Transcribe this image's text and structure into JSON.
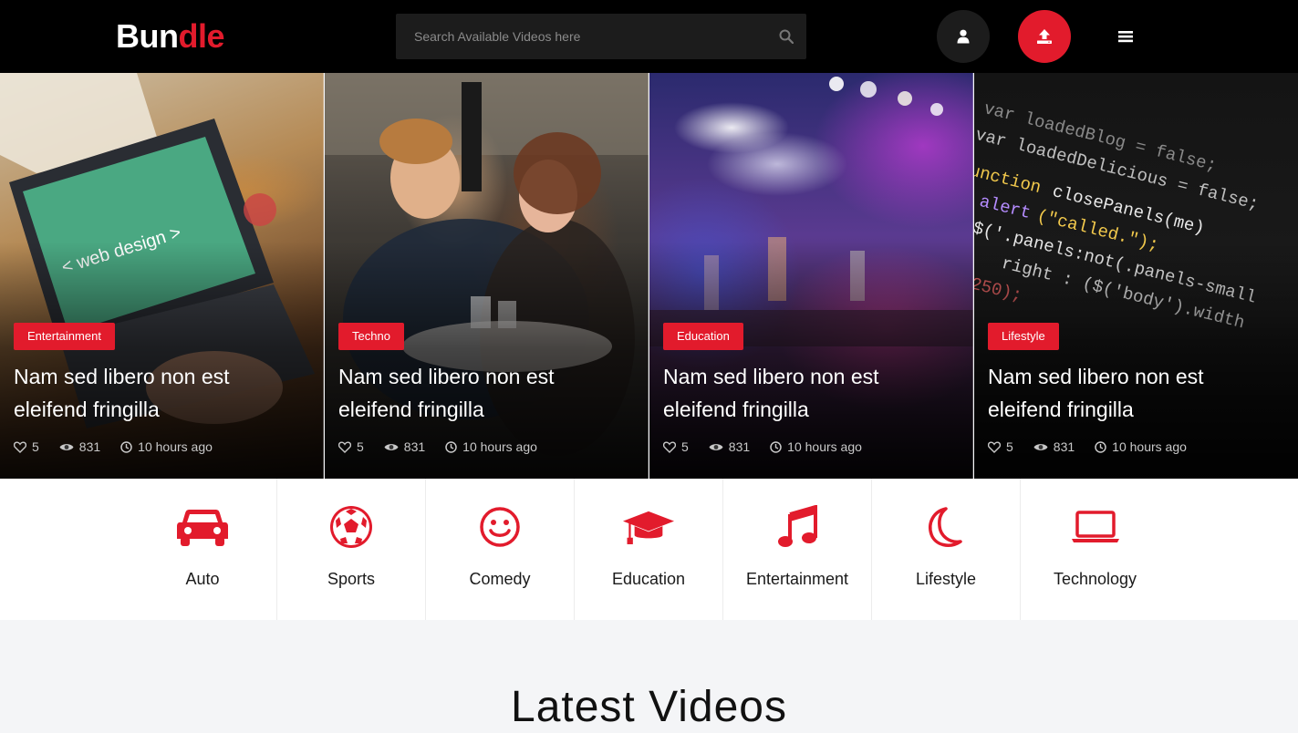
{
  "logo": {
    "part1": "Bun",
    "part2": "dle"
  },
  "search": {
    "placeholder": "Search Available Videos here"
  },
  "header_icons": {
    "user": "user-icon",
    "upload": "upload-icon",
    "menu": "hamburger-menu-icon"
  },
  "colors": {
    "accent": "#e21b2c",
    "header_bg": "#000000"
  },
  "cards": [
    {
      "category": "Entertainment",
      "title": "Nam sed libero non est eleifend fringilla",
      "likes": "5",
      "views": "831",
      "time": "10 hours ago"
    },
    {
      "category": "Techno",
      "title": "Nam sed libero non est eleifend fringilla",
      "likes": "5",
      "views": "831",
      "time": "10 hours ago"
    },
    {
      "category": "Education",
      "title": "Nam sed libero non est eleifend fringilla",
      "likes": "5",
      "views": "831",
      "time": "10 hours ago"
    },
    {
      "category": "Lifestyle",
      "title": "Nam sed libero non est eleifend fringilla",
      "likes": "5",
      "views": "831",
      "time": "10 hours ago"
    }
  ],
  "categories": [
    {
      "label": "Auto",
      "icon": "car-icon"
    },
    {
      "label": "Sports",
      "icon": "soccer-ball-icon"
    },
    {
      "label": "Comedy",
      "icon": "smiley-icon"
    },
    {
      "label": "Education",
      "icon": "graduation-cap-icon"
    },
    {
      "label": "Entertainment",
      "icon": "music-note-icon"
    },
    {
      "label": "Lifestyle",
      "icon": "moon-icon"
    },
    {
      "label": "Technology",
      "icon": "laptop-icon"
    }
  ],
  "latest": {
    "title": "Latest Videos"
  }
}
